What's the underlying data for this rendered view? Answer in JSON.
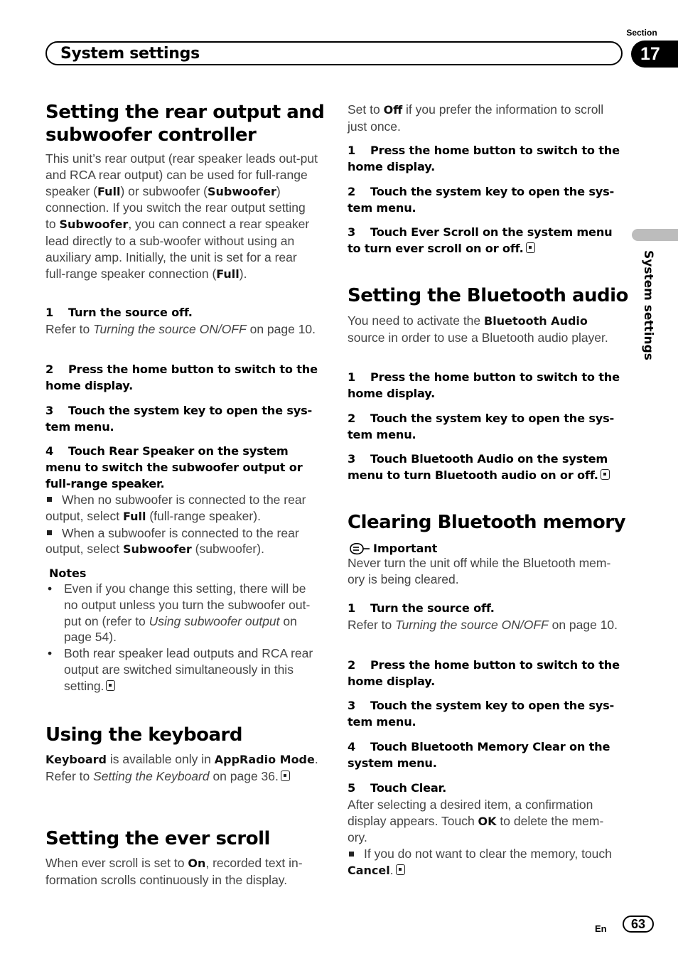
{
  "header": {
    "section_label": "Section",
    "section_number": "17",
    "title": "System settings",
    "side_tab_text": "System settings"
  },
  "left": {
    "rear_output": {
      "heading": "Setting the rear output and subwoofer controller",
      "intro": [
        {
          "t": "This unit’s rear output (rear speaker leads out-put and RCA rear output) can be used for full-range speaker ("
        },
        {
          "b": "Full"
        },
        {
          "t": ") or subwoofer ("
        },
        {
          "b": "Subwoofer"
        },
        {
          "t": ") connection. If you switch the rear output setting to "
        },
        {
          "b": "Subwoofer"
        },
        {
          "t": ", you can connect a rear speaker lead directly to a sub-woofer without using an auxiliary amp. Initially, the unit is set for a rear full-range speaker connection ("
        },
        {
          "b": "Full"
        },
        {
          "t": ")."
        }
      ],
      "steps": [
        {
          "num": "1",
          "text": "Turn the source off.",
          "detail_prefix": "Refer to ",
          "detail_italic": "Turning the source ON/OFF",
          "detail_suffix": " on page 10."
        },
        {
          "num": "2",
          "text": "Press the home button to switch to the home display."
        },
        {
          "num": "3",
          "text": "Touch the system key to open the sys-tem menu."
        },
        {
          "num": "4",
          "text": "Touch Rear Speaker on the system menu to switch the subwoofer output or full-range speaker."
        }
      ],
      "bullets": [
        {
          "pre": "When no subwoofer is connected to the rear output, select ",
          "bold": "Full",
          "post": " (full-range speaker)."
        },
        {
          "pre": "When a subwoofer is connected to the rear output, select ",
          "bold": "Subwoofer",
          "post": " (subwoofer)."
        }
      ],
      "notes_title": "Notes",
      "notes": [
        {
          "pre": "Even if you change this setting, there will be no output unless you turn the subwoofer out-put on (refer to ",
          "italic": "Using subwoofer output",
          "post": " on page 54)."
        },
        {
          "pre": "Both rear speaker lead outputs and RCA rear output are switched simultaneously in this setting.",
          "italic": "",
          "post": ""
        }
      ]
    },
    "keyboard": {
      "heading": "Using the keyboard",
      "b1": "Keyboard",
      "t1": " is available only in ",
      "b2": "AppRadio Mode",
      "t2": ".",
      "ref_prefix": "Refer to ",
      "ref_italic": "Setting the Keyboard",
      "ref_suffix": " on page 36."
    },
    "ever_scroll": {
      "heading": "Setting the ever scroll",
      "t1": "When ever scroll is set to ",
      "b1": "On",
      "t2": ", recorded text in-formation scrolls continuously in the display."
    }
  },
  "right": {
    "ever_scroll_cont": {
      "t1": "Set to ",
      "b1": "Off",
      "t2": " if you prefer the information to scroll just once.",
      "steps": [
        {
          "num": "1",
          "text": "Press the home button to switch to the home display."
        },
        {
          "num": "2",
          "text": "Touch the system key to open the sys-tem menu."
        },
        {
          "num": "3",
          "text": "Touch Ever Scroll on the system menu to turn ever scroll on or off."
        }
      ]
    },
    "bt_audio": {
      "heading": "Setting the Bluetooth audio",
      "t1": "You need to activate the ",
      "b1": "Bluetooth Audio",
      "t2": " source in order to use a Bluetooth audio player.",
      "steps": [
        {
          "num": "1",
          "text": "Press the home button to switch to the home display."
        },
        {
          "num": "2",
          "text": "Touch the system key to open the sys-tem menu."
        },
        {
          "num": "3",
          "text": "Touch Bluetooth Audio on the system menu to turn Bluetooth audio on or off."
        }
      ]
    },
    "bt_memory": {
      "heading": "Clearing Bluetooth memory",
      "important_label": "Important",
      "important_text": "Never turn the unit off while the Bluetooth mem-ory is being cleared.",
      "steps": [
        {
          "num": "1",
          "text": "Turn the source off.",
          "detail_prefix": "Refer to ",
          "detail_italic": "Turning the source ON/OFF",
          "detail_suffix": " on page 10."
        },
        {
          "num": "2",
          "text": "Press the home button to switch to the home display."
        },
        {
          "num": "3",
          "text": "Touch the system key to open the sys-tem menu."
        },
        {
          "num": "4",
          "text": "Touch Bluetooth Memory Clear on the system menu."
        },
        {
          "num": "5",
          "text": "Touch Clear."
        }
      ],
      "after_t1": "After selecting a desired item, a confirmation display appears. Touch ",
      "after_b1": "OK",
      "after_t2": " to delete the mem-ory.",
      "bullet_pre": "If you do not want to clear the memory, touch ",
      "bullet_bold": "Cancel",
      "bullet_post": "."
    }
  },
  "footer": {
    "lang": "En",
    "page": "63"
  }
}
